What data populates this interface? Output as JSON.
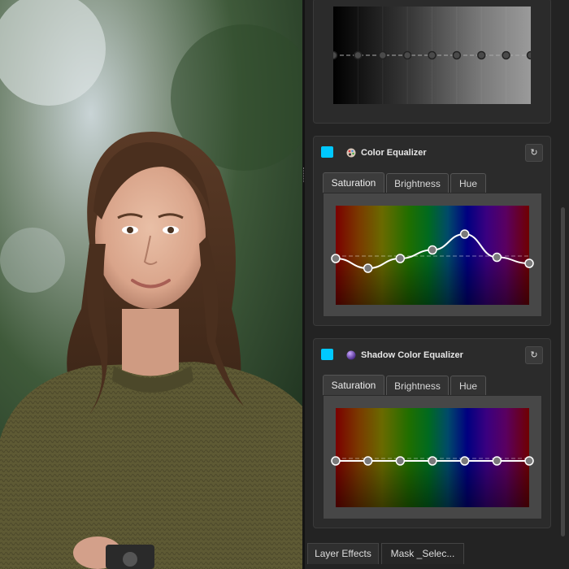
{
  "colors": {
    "accent": "#00c8ff",
    "panel_bg": "#232323",
    "card_bg": "#2b2b2b"
  },
  "photo": {
    "subject": "portrait-photo"
  },
  "tone_card": {
    "curve_points": 9
  },
  "color_equalizer": {
    "title": "Color Equalizer",
    "icon": "palette-icon",
    "enabled": true,
    "reset_icon": "reset-icon",
    "tabs": [
      "Saturation",
      "Brightness",
      "Hue"
    ],
    "active_tab": "Saturation",
    "curve": [
      0,
      -0.08,
      0.0,
      0.07,
      0.2,
      0.01,
      -0.04
    ]
  },
  "shadow_color_equalizer": {
    "title": "Shadow Color Equalizer",
    "icon": "sphere-icon",
    "enabled": true,
    "reset_icon": "reset-icon",
    "tabs": [
      "Saturation",
      "Brightness",
      "Hue"
    ],
    "active_tab": "Saturation",
    "curve": [
      0,
      0,
      0,
      0,
      0,
      0,
      0
    ]
  },
  "bottom_tabs": [
    "Layer Effects",
    "Mask _Selec..."
  ],
  "active_bottom_tab": "Layer Effects"
}
